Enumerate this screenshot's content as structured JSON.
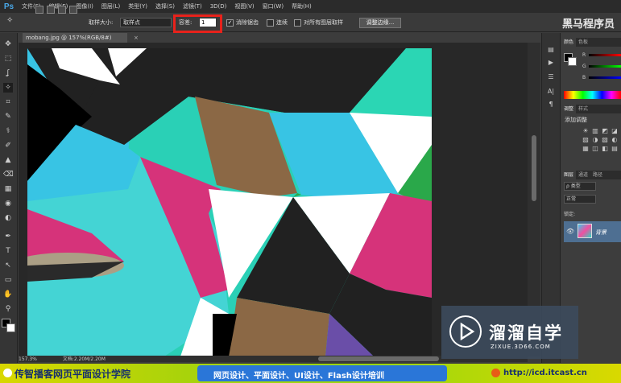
{
  "app": {
    "logo": "Ps"
  },
  "menu": [
    "文件(F)",
    "编辑(E)",
    "图像(I)",
    "图层(L)",
    "类型(Y)",
    "选择(S)",
    "滤镜(T)",
    "3D(D)",
    "视图(V)",
    "窗口(W)",
    "帮助(H)"
  ],
  "options": {
    "sample_size_label": "取样大小:",
    "sample_size_value": "取样点",
    "tolerance_label": "容差:",
    "tolerance_value": "1",
    "antialias_label": "消除锯齿",
    "antialias_checked": "✓",
    "contiguous_label": "连续",
    "all_layers_label": "对所有图层取样",
    "refine_edge": "调整边缘...",
    "watermark": "黑马程序员"
  },
  "document": {
    "tab": "mobang.jpg @ 157%(RGB/8#)",
    "close": "×",
    "zoom": "157.3%",
    "doc_size": "文档:2.20M/2.20M"
  },
  "tools": [
    "✥",
    "⬚",
    "ʆ",
    "✧",
    "⌗",
    "✎",
    "⚕",
    "✐",
    "▲",
    "⌫",
    "▦",
    "◉",
    "◐",
    "✒",
    "T",
    "↖",
    "▭",
    "✋",
    "⚲"
  ],
  "panels": {
    "color_tabs": [
      "颜色",
      "色板"
    ],
    "color_channels": [
      "R",
      "G",
      "B"
    ],
    "adjust_tabs": [
      "调整",
      "样式"
    ],
    "adjust_title": "添加调整",
    "adjust_icons": [
      "☀",
      "▥",
      "◩",
      "◪",
      "▨",
      "◑",
      "▧",
      "◐",
      "▦",
      "◫",
      "◧",
      "▤"
    ],
    "layers_tabs": [
      "图层",
      "通道",
      "路径"
    ],
    "layers_filter": "ρ 类型",
    "blend_mode": "正常",
    "lock_label": "锁定:",
    "layer_name": "背景"
  },
  "watermark": {
    "title": "溜溜自学",
    "sub": "ZIXUE.3D66.COM"
  },
  "banner": {
    "left": "传智播客网页平面设计学院",
    "middle": "网页设计、平面设计、UI设计、Flash设计培训",
    "right": "http://icd.itcast.cn"
  }
}
